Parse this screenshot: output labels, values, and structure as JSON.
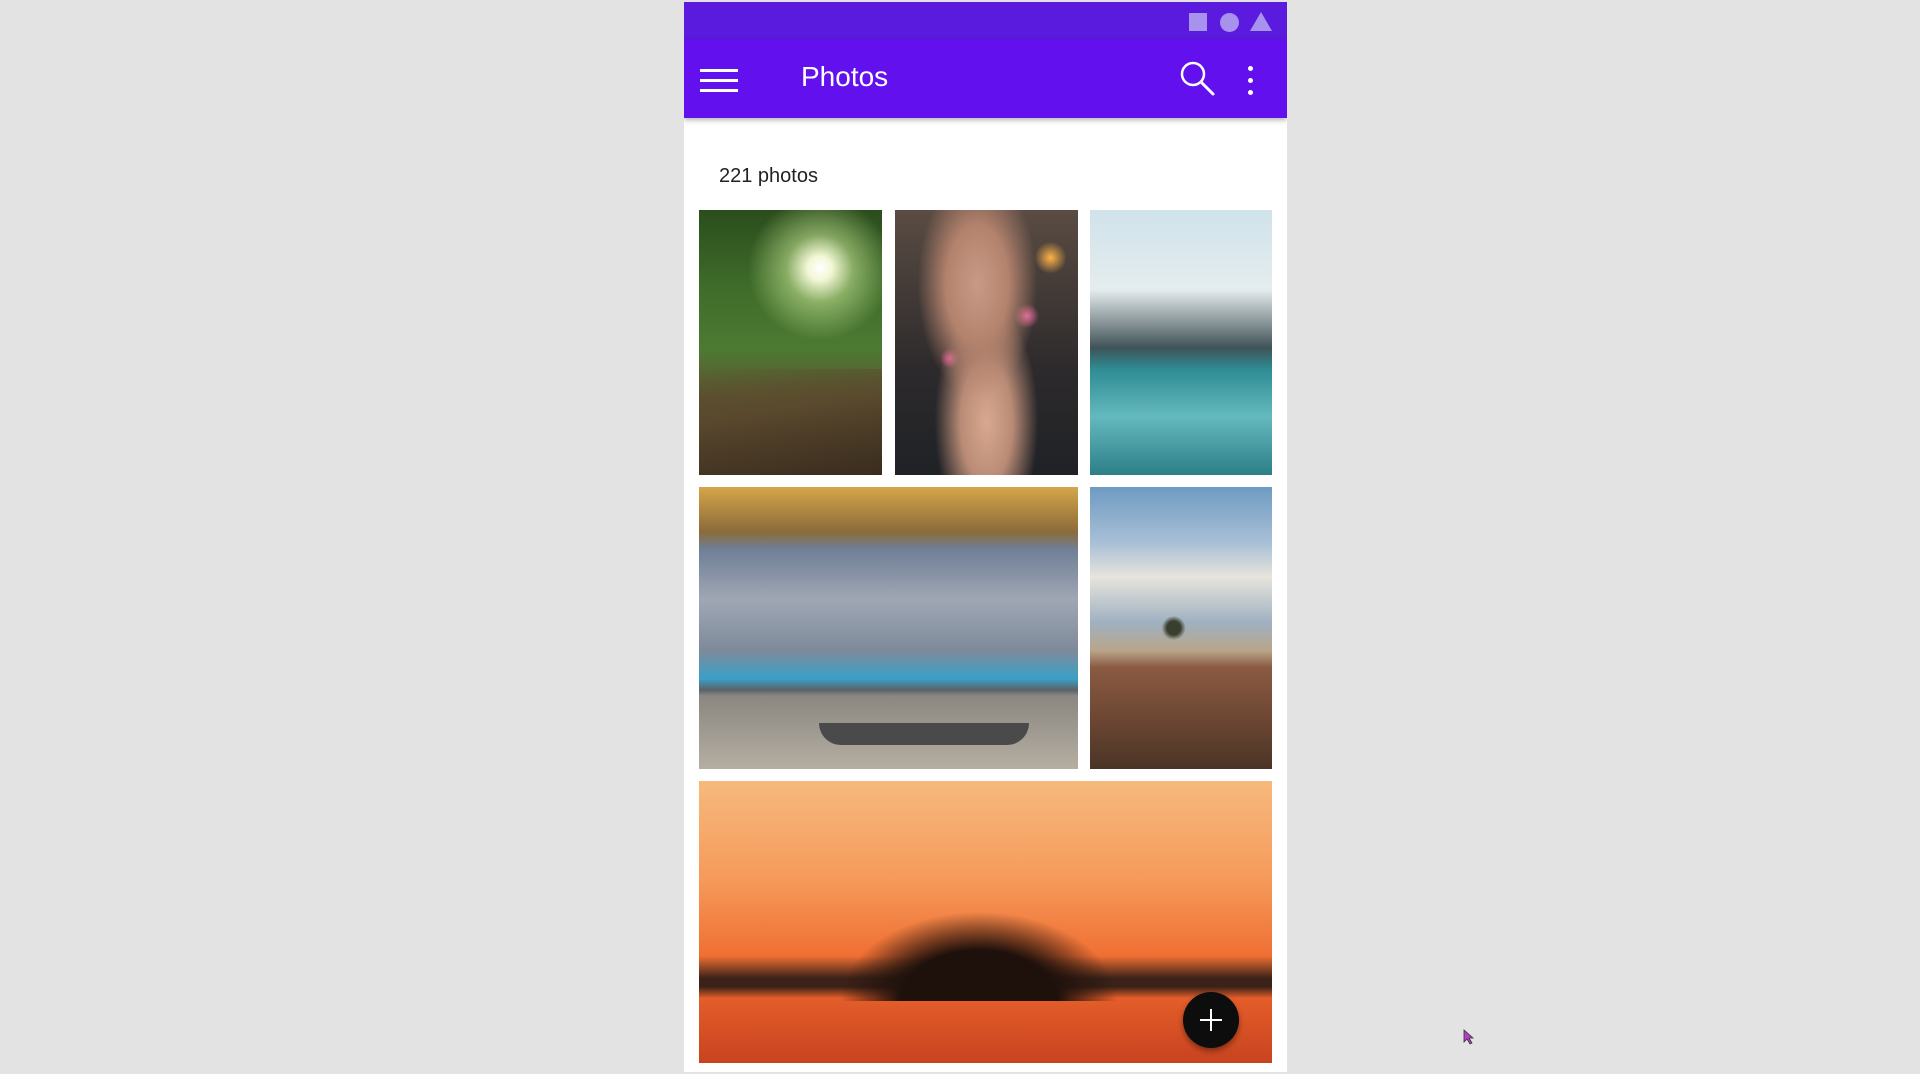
{
  "app_bar": {
    "title": "Photos",
    "color": "#6210ee",
    "icons": [
      "menu-icon",
      "search-icon",
      "more-vert-icon"
    ]
  },
  "status_bar": {
    "color": "#5a1bdf",
    "icons": [
      "square-icon",
      "circle-icon",
      "triangle-icon"
    ]
  },
  "gallery": {
    "count_label": "221 photos",
    "photos": [
      {
        "subject": "forest path with sunlight"
      },
      {
        "subject": "woman blowing confetti"
      },
      {
        "subject": "mountain lake reflection"
      },
      {
        "subject": "modern interior with large windows"
      },
      {
        "subject": "lone tree in field"
      },
      {
        "subject": "sunset over island with trees"
      }
    ]
  },
  "fab": {
    "icon": "add-icon",
    "color": "#0d0d0d"
  }
}
